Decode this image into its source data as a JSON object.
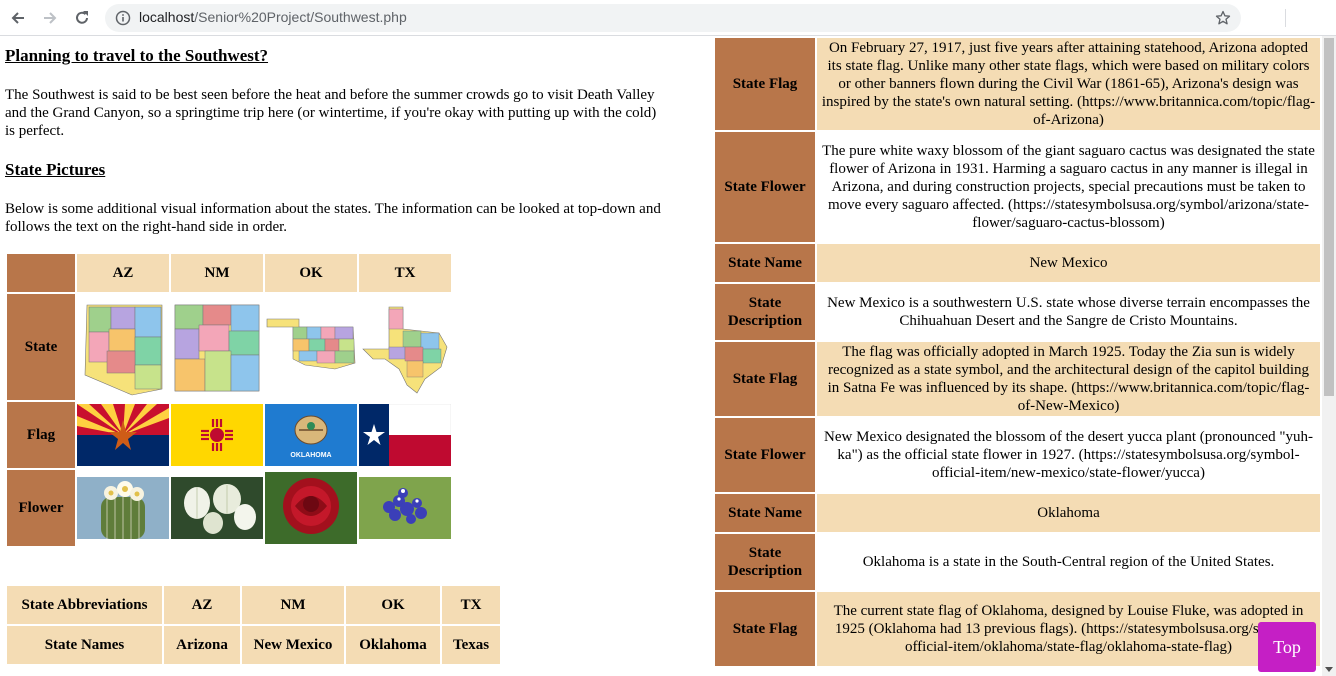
{
  "browser": {
    "url_host": "localhost",
    "url_path": "/Senior%20Project/Southwest.php",
    "back_icon": "back-arrow-icon",
    "forward_icon": "forward-arrow-icon",
    "reload_icon": "reload-icon",
    "info_icon": "info-icon",
    "bookmark_icon": "star-icon"
  },
  "intro": {
    "heading": "Planning to travel to the Southwest?",
    "text": "The Southwest is said to be best seen before the heat and before the summer crowds go to visit Death Valley and the Grand Canyon, so a springtime trip here (or wintertime, if you're okay with putting up with the cold) is perfect."
  },
  "pictures": {
    "heading": "State Pictures",
    "text": "Below is some additional visual information about the states. The information can be looked at top-down and follows the text on the right-hand side in order.",
    "columns": [
      "AZ",
      "NM",
      "OK",
      "TX"
    ],
    "rows": [
      "State",
      "Flag",
      "Flower"
    ]
  },
  "abbreviations": {
    "row1_label": "State Abbreviations",
    "row1": [
      "AZ",
      "NM",
      "OK",
      "TX"
    ],
    "row2_label": "State Names",
    "row2": [
      "Arizona",
      "New Mexico",
      "Oklahoma",
      "Texas"
    ]
  },
  "info_rows": [
    {
      "label": "",
      "value": "",
      "shade": "shade"
    },
    {
      "label": "State Flag",
      "value": "On February 27, 1917, just five years after attaining statehood, Arizona adopted its state flag. Unlike many other state flags, which were based on military colors or other banners flown during the Civil War (1861-65), Arizona's design was inspired by the state's own natural setting. (https://www.britannica.com/topic/flag-of-Arizona)",
      "shade": "shade"
    },
    {
      "label": "State Flower",
      "value": "The pure white waxy blossom of the giant saguaro cactus was designated the state flower of Arizona in 1931. Harming a saguaro cactus in any manner is illegal in Arizona, and during construction projects, special precautions must be taken to move every saguaro affected. (https://statesymbolsusa.org/symbol/arizona/state-flower/saguaro-cactus-blossom)",
      "shade": "plain"
    },
    {
      "label": "State Name",
      "value": "New Mexico",
      "shade": "shade"
    },
    {
      "label": "State Description",
      "value": "New Mexico is a southwestern U.S. state whose diverse terrain encompasses the Chihuahuan Desert and the Sangre de Cristo Mountains.",
      "shade": "plain"
    },
    {
      "label": "State Flag",
      "value": "The flag was officially adopted in March 1925. Today the Zia sun is widely recognized as a state symbol, and the architectural design of the capitol building in Satna Fe was influenced by its shape. (https://www.britannica.com/topic/flag-of-New-Mexico)",
      "shade": "shade"
    },
    {
      "label": "State Flower",
      "value": "New Mexico designated the blossom of the desert yucca plant (pronounced \"yuh-ka\") as the official state flower in 1927. (https://statesymbolsusa.org/symbol-official-item/new-mexico/state-flower/yucca)",
      "shade": "plain"
    },
    {
      "label": "State Name",
      "value": "Oklahoma",
      "shade": "shade"
    },
    {
      "label": "State Description",
      "value": "Oklahoma is a state in the South-Central region of the United States.",
      "shade": "plain"
    },
    {
      "label": "State Flag",
      "value": "The current state flag of Oklahoma, designed by Louise Fluke, was adopted in 1925 (Oklahoma had 13 previous flags). (https://statesymbolsusa.org/symbol-official-item/oklahoma/state-flag/oklahoma-state-flag)",
      "shade": "shade"
    }
  ],
  "top_button": "Top",
  "flag_text_ok": "OKLAHOMA",
  "colors": {
    "tan": "#f4dcb4",
    "brown": "#b8764a",
    "top_button": "#c51fc5"
  }
}
